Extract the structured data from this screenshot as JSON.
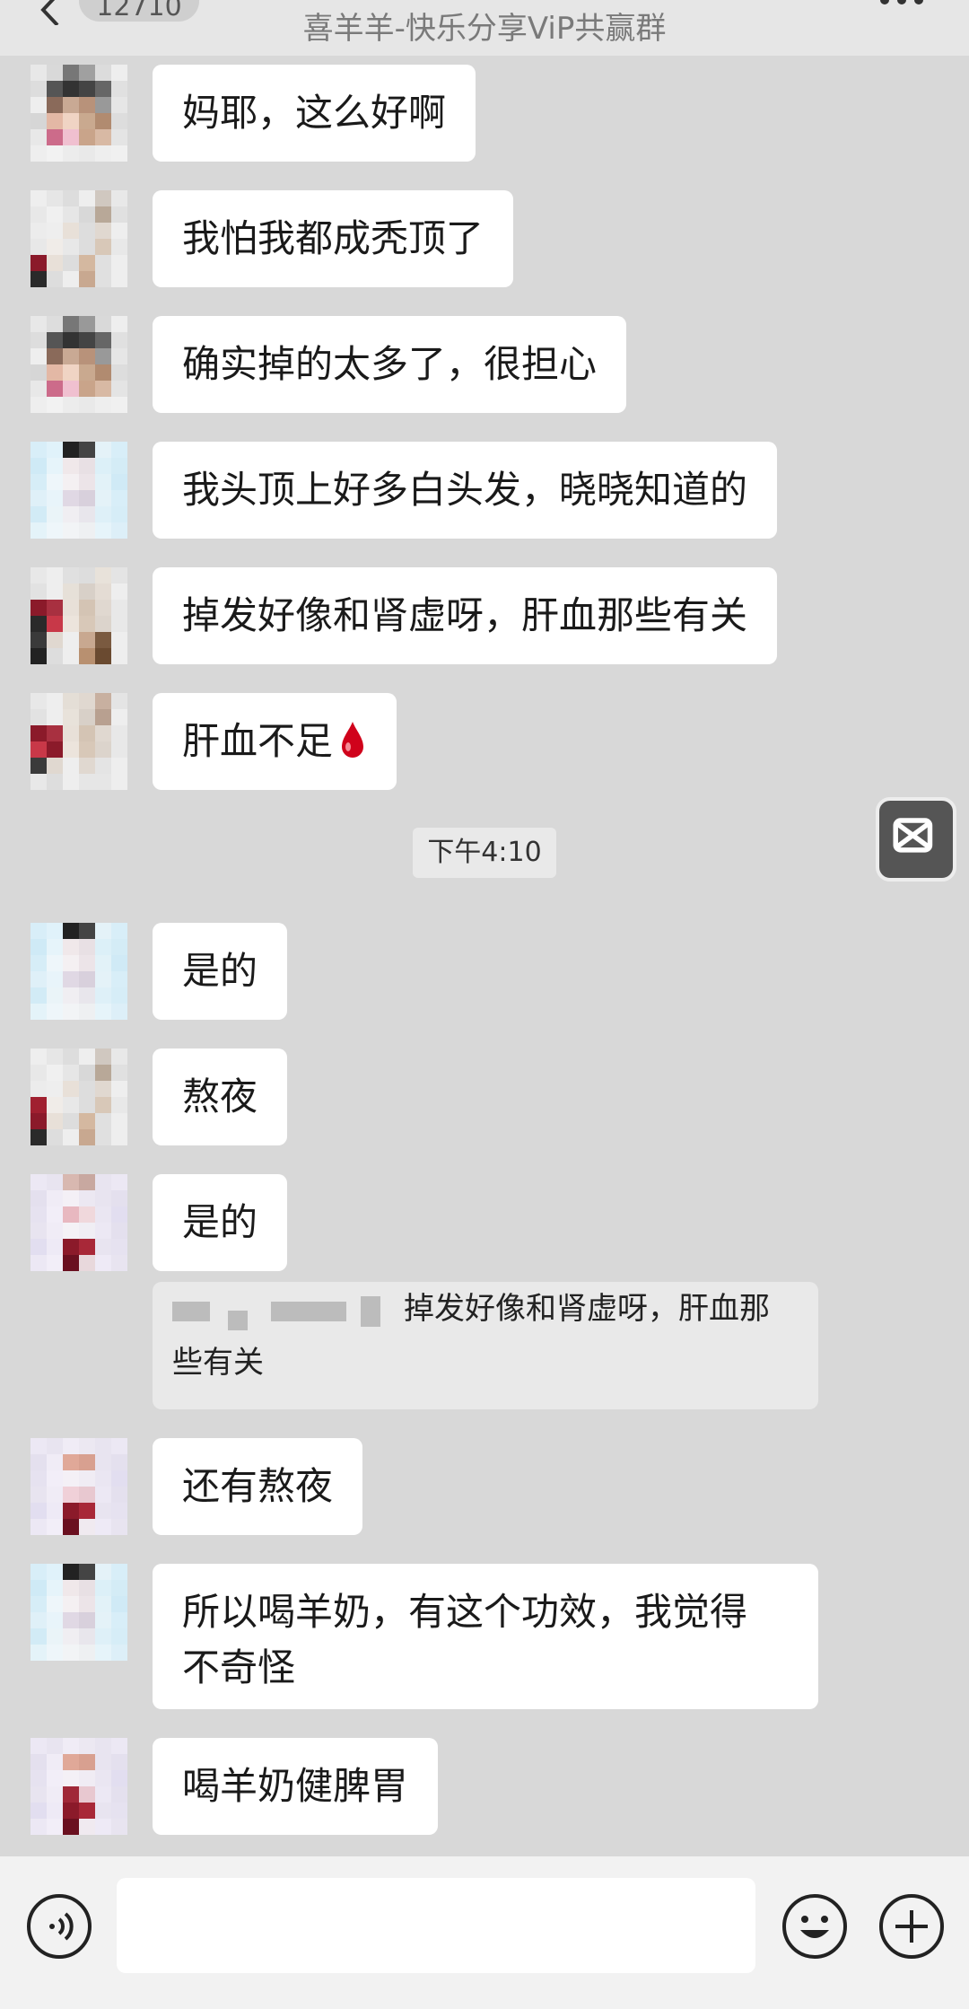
{
  "header": {
    "unread_count": "12710",
    "group_name": "喜羊羊-快乐分享ViP共赢群"
  },
  "messages": [
    {
      "text": "妈耶，这么好啊"
    },
    {
      "text": "我怕我都成秃顶了"
    },
    {
      "text": "确实掉的太多了，很担心"
    },
    {
      "text": "我头顶上好多白头发，晓晓知道的"
    },
    {
      "text": "掉发好像和肾虚呀，肝血那些有关"
    },
    {
      "text": "肝血不足",
      "emoji": "blood-drop"
    },
    {
      "text": "是的"
    },
    {
      "text": "熬夜"
    },
    {
      "text": "是的"
    },
    {
      "text": "还有熬夜"
    },
    {
      "text": "所以喝羊奶，有这个功效，我觉得\n不奇怪"
    },
    {
      "text": "喝羊奶健脾胃"
    }
  ],
  "timestamp": "下午4:10",
  "quoted_message": "掉发好像和肾虚呀，肝血那些有关",
  "input_bar": {
    "placeholder": "",
    "voice_icon": "voice-icon",
    "emoji_icon": "emoji-icon",
    "plus_icon": "plus-icon"
  },
  "colors": {
    "background": "#d8d8d8",
    "bubble": "#ffffff",
    "input_bar": "#f2f2f2",
    "blood_drop": "#d0021b"
  }
}
